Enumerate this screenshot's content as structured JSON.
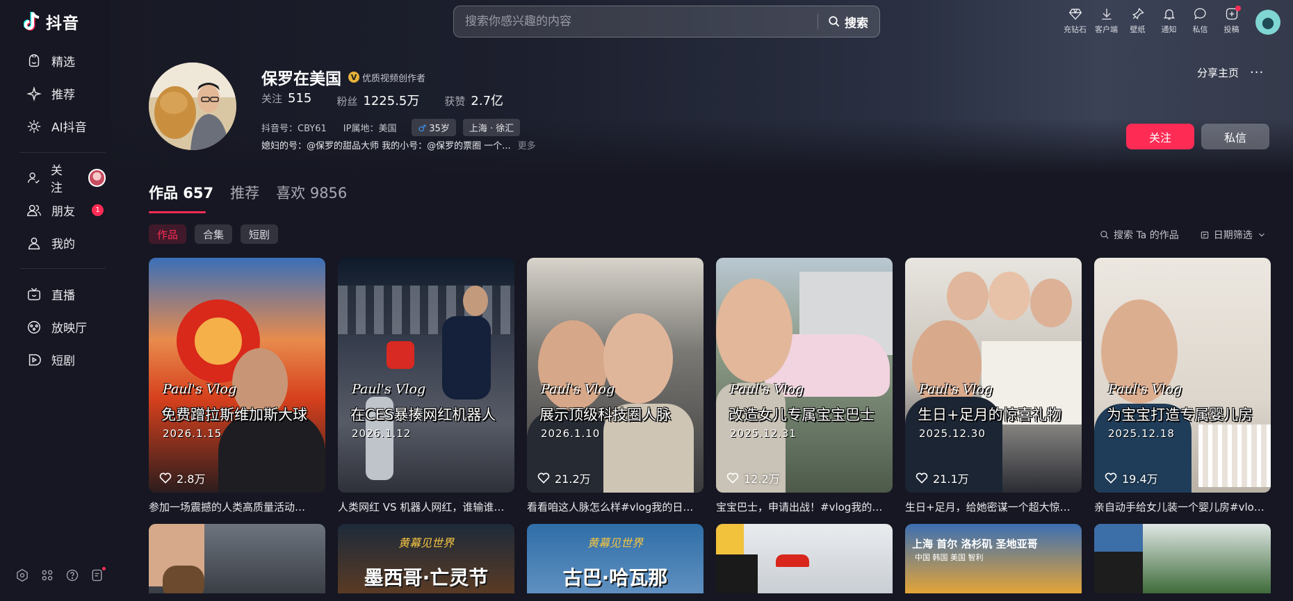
{
  "app": {
    "logo_text": "抖音",
    "brand_color": "#fe2c55"
  },
  "sidebar": {
    "items": [
      {
        "label": "精选",
        "icon": "featured-icon"
      },
      {
        "label": "推荐",
        "icon": "sparkle-icon"
      },
      {
        "label": "AI抖音",
        "icon": "ai-icon"
      },
      {
        "label": "关注",
        "icon": "follow-icon"
      },
      {
        "label": "朋友",
        "icon": "friends-icon",
        "badge": "1"
      },
      {
        "label": "我的",
        "icon": "user-icon"
      },
      {
        "label": "直播",
        "icon": "live-icon"
      },
      {
        "label": "放映厅",
        "icon": "cinema-icon"
      },
      {
        "label": "短剧",
        "icon": "drama-icon"
      }
    ],
    "bottom_icons": [
      "settings-icon",
      "apps-icon",
      "help-icon",
      "feedback-icon"
    ]
  },
  "search": {
    "placeholder": "搜索你感兴趣的内容",
    "button_label": "搜索"
  },
  "top_actions": [
    {
      "label": "充钻石",
      "icon": "diamond-icon"
    },
    {
      "label": "客户端",
      "icon": "download-icon"
    },
    {
      "label": "壁纸",
      "icon": "wallpaper-icon"
    },
    {
      "label": "通知",
      "icon": "bell-icon"
    },
    {
      "label": "私信",
      "icon": "message-icon"
    },
    {
      "label": "投稿",
      "icon": "upload-icon"
    }
  ],
  "profile": {
    "name": "保罗在美国",
    "verified_label": "优质视频创作者",
    "stats": {
      "following_label": "关注",
      "following": "515",
      "fans_label": "粉丝",
      "fans": "1225.5万",
      "likes_label": "获赞",
      "likes": "2.7亿"
    },
    "douyin_id": "抖音号：CBY61",
    "ip_location": "IP属地：美国",
    "age_tag": "35岁",
    "location_tag": "上海 · 徐汇",
    "bio": "媳妇的号：@保罗的甜品大师  我的小号：@保罗的票圈  一个...",
    "more_label": "更多",
    "share_label": "分享主页",
    "follow_button": "关注",
    "message_button": "私信"
  },
  "tabs": [
    {
      "label": "作品 657",
      "active": true
    },
    {
      "label": "推荐",
      "active": false
    },
    {
      "label": "喜欢 9856",
      "active": false
    }
  ],
  "filters": [
    {
      "label": "作品",
      "active": true
    },
    {
      "label": "合集",
      "active": false
    },
    {
      "label": "短剧",
      "active": false
    }
  ],
  "tools": {
    "search_works": "搜索 Ta 的作品",
    "date_filter": "日期筛选"
  },
  "videos": [
    {
      "vlog": "Paul's Vlog",
      "title": "免费蹭拉斯维加斯大球",
      "date": "2026.1.15",
      "likes": "2.8万",
      "caption": "参加一场震撼的人类高质量活动…"
    },
    {
      "vlog": "Paul's Vlog",
      "title": "在CES暴揍网红机器人",
      "date": "2026.1.12",
      "likes": "",
      "caption": "人类网红 VS 机器人网红，谁输谁…"
    },
    {
      "vlog": "Paul's Vlog",
      "title": "展示顶级科技圈人脉",
      "date": "2026.1.10",
      "likes": "21.2万",
      "caption": "看看咱这人脉怎么样#vlog我的日…"
    },
    {
      "vlog": "Paul's Vlog",
      "title": "改造女儿专属宝宝巴士",
      "date": "2025.12.31",
      "likes": "12.2万",
      "caption": "宝宝巴士，申请出战！#vlog我的…"
    },
    {
      "vlog": "Paul's Vlog",
      "title": "生日+足月的惊喜礼物",
      "date": "2025.12.30",
      "likes": "21.1万",
      "caption": "生日+足月，给她密谋一个超大惊…"
    },
    {
      "vlog": "Paul's Vlog",
      "title": "为宝宝打造专属婴儿房",
      "date": "2025.12.18",
      "likes": "19.4万",
      "caption": "亲自动手给女儿装一个婴儿房#vlo…"
    }
  ],
  "videos_row2": [
    {
      "overlay": ""
    },
    {
      "overlay_small": "黄幕见世界",
      "overlay": "墨西哥·亡灵节"
    },
    {
      "overlay_small": "黄幕见世界",
      "overlay": "古巴·哈瓦那"
    },
    {
      "overlay": ""
    },
    {
      "overlay": "上海 首尔 洛杉矶 圣地亚哥",
      "overlay_sub": "中国  韩国   美国   智利"
    },
    {
      "overlay": ""
    }
  ]
}
